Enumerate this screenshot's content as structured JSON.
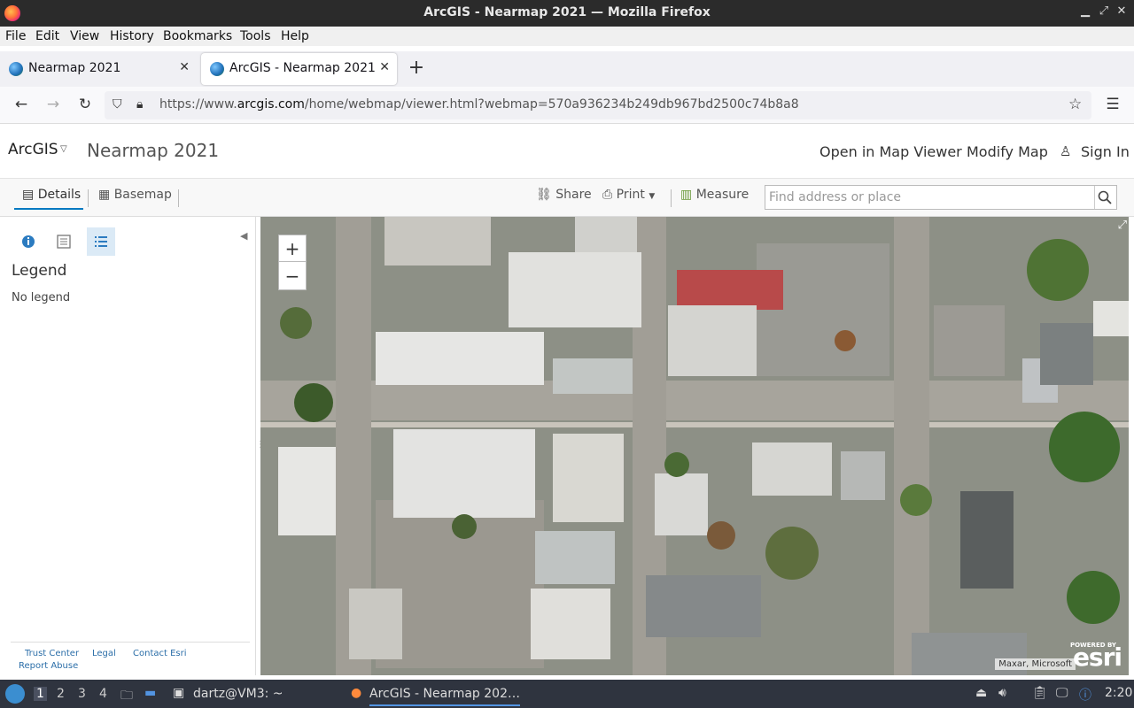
{
  "window": {
    "title": "ArcGIS - Nearmap 2021 — Mozilla Firefox"
  },
  "menu": [
    "File",
    "Edit",
    "View",
    "History",
    "Bookmarks",
    "Tools",
    "Help"
  ],
  "tabs": [
    {
      "label": "Nearmap 2021"
    },
    {
      "label": "ArcGIS - Nearmap 2021"
    }
  ],
  "url": {
    "prefix": "https://www.",
    "domain": "arcgis.com",
    "path": "/home/webmap/viewer.html?webmap=570a936234b249db967bd2500c74b8a8"
  },
  "header": {
    "brand": "ArcGIS",
    "map_title": "Nearmap 2021",
    "open_map_viewer": "Open in Map Viewer",
    "modify_map": "Modify Map",
    "sign_in": "Sign In"
  },
  "toolbar": {
    "details": "Details",
    "basemap": "Basemap",
    "share": "Share",
    "print": "Print",
    "measure": "Measure",
    "search_placeholder": "Find address or place"
  },
  "panel": {
    "legend_title": "Legend",
    "no_legend": "No legend",
    "footer": {
      "trust_center": "Trust Center",
      "legal": "Legal",
      "contact_esri": "Contact Esri",
      "report_abuse": "Report Abuse"
    }
  },
  "map": {
    "zoom_in": "+",
    "zoom_out": "−",
    "attribution": "Maxar, Microsoft",
    "powered_by": "POWERED BY",
    "esri_logo": "esri"
  },
  "taskbar": {
    "workspaces": [
      "1",
      "2",
      "3",
      "4"
    ],
    "terminal_task": "dartz@VM3: ~",
    "firefox_task": "ArcGIS - Nearmap 202…",
    "clock": "2:20"
  },
  "colors": {
    "accent": "#0079c1",
    "taskbar": "#2f343f"
  }
}
